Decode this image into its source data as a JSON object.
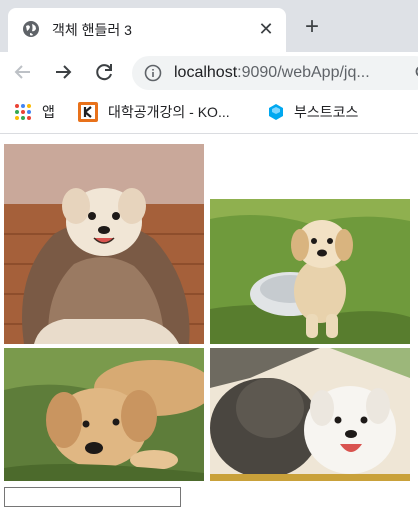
{
  "tab": {
    "title": "객체 핸들러 3",
    "favicon": "globe-icon",
    "close_icon": "close-icon",
    "new_tab_icon": "plus-icon"
  },
  "toolbar": {
    "back_icon": "back-arrow-icon",
    "forward_icon": "forward-arrow-icon",
    "reload_icon": "reload-icon",
    "url_host": "localhost",
    "url_path": ":9090/webApp/jq...",
    "site_info_icon": "info-icon"
  },
  "bookmarks": [
    {
      "label": "앱",
      "icon": "apps-grid-icon"
    },
    {
      "label": "대학공개강의 - KO...",
      "icon": "kocw-logo-icon",
      "accent": "#e8711a"
    },
    {
      "label": "부스트코스",
      "icon": "boostcourse-icon",
      "accent": "#00a8f0"
    }
  ],
  "page": {
    "images": [
      {
        "name": "puppy-in-blanket",
        "alt": ""
      },
      {
        "name": "puppy-in-bowl",
        "alt": ""
      },
      {
        "name": "puppy-lying-on-grass",
        "alt": ""
      },
      {
        "name": "two-dogs-cuddling",
        "alt": ""
      }
    ],
    "input_value": ""
  },
  "colors": {
    "tabstrip": "#dee1e6",
    "omnibox": "#f1f3f4",
    "icon": "#5f6368"
  }
}
